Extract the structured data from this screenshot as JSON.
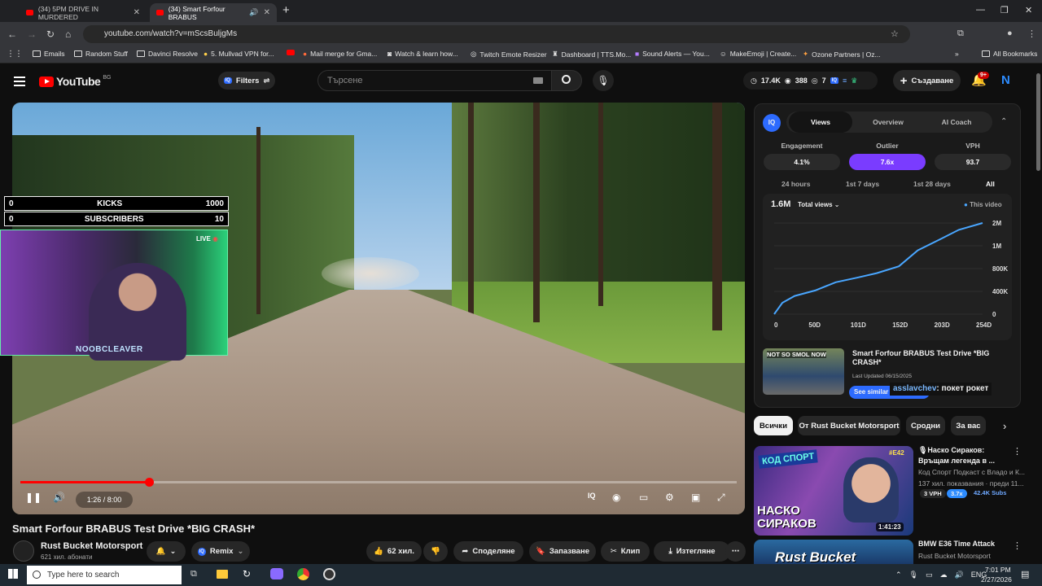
{
  "browser": {
    "tabs": [
      {
        "label": "(34) 5PM DRIVE IN MURDERED"
      },
      {
        "label": "(34) Smart Forfour BRABUS"
      }
    ],
    "url": "youtube.com/watch?v=mScsBuljgMs",
    "bookmarks": [
      "Emails",
      "Random Stuff",
      "Davinci Resolve",
      "5. Mullvad VPN for...",
      "Mail merge for Gma...",
      "Watch & learn how...",
      "Twitch Emote Resizer",
      "Dashboard | TTS.Mo...",
      "Sound Alerts — You...",
      "MakeEmoji | Create...",
      "Ozone Partners | Oz...",
      "All Bookmarks"
    ]
  },
  "header": {
    "logo": "YouTube",
    "region": "BG",
    "filters_label": "Filters",
    "search_placeholder": "Търсене",
    "stats": [
      "17.4K",
      "388",
      "7"
    ],
    "create_label": "Създаване",
    "notif_badge": "9+"
  },
  "video": {
    "kicks": {
      "left": "0",
      "label": "KICKS",
      "right": "1000"
    },
    "subs": {
      "left": "0",
      "label": "SUBSCRIBERS",
      "right": "10"
    },
    "cam_name": "NOOBCLEAVER",
    "live": "LIVE",
    "time": "1:26 / 8:00",
    "progress": 0.18,
    "title": "Smart Forfour BRABUS Test Drive *BIG CRASH*",
    "channel": "Rust Bucket Motorsport",
    "subs_count": "621 хил. абонати",
    "remix": "Remix",
    "likes": "62 хил.",
    "share": "Споделяне",
    "save": "Запазване",
    "clip": "Клип",
    "download": "Изтегляне"
  },
  "vidiq": {
    "tabs": [
      "Views",
      "Overview",
      "AI Coach"
    ],
    "stats": [
      {
        "label": "Engagement",
        "value": "4.1%"
      },
      {
        "label": "Outlier",
        "value": "7.6x"
      },
      {
        "label": "VPH",
        "value": "93.7"
      }
    ],
    "ranges": [
      "24 hours",
      "1st 7 days",
      "1st 28 days",
      "All"
    ],
    "total": "1.6M",
    "metric_select": "Total views",
    "legend": "This video",
    "similar_title": "Smart Forfour BRABUS Test Drive *BIG CRASH*",
    "last_updated": "Last Updated 06/15/2025",
    "similar_btn": "See similar thumbnails",
    "thumb_text": "NOT SO SMOL NOW",
    "chat_user": "asslavchev",
    "chat_msg": ": покет рокет"
  },
  "chart_data": {
    "type": "line",
    "series": [
      {
        "values": [
          [
            0,
            0
          ],
          [
            10,
            250000
          ],
          [
            25,
            400000
          ],
          [
            50,
            520000
          ],
          [
            75,
            700000
          ],
          [
            101,
            800000
          ],
          [
            125,
            900000
          ],
          [
            152,
            1050000
          ],
          [
            175,
            1400000
          ],
          [
            203,
            1650000
          ],
          [
            225,
            1850000
          ],
          [
            254,
            2000000
          ]
        ]
      }
    ],
    "x_ticks": [
      "0",
      "50D",
      "101D",
      "152D",
      "203D",
      "254D"
    ],
    "y_ticks": [
      "2M",
      "1M",
      "800K",
      "400K",
      "0"
    ],
    "xlim": [
      0,
      254
    ],
    "ylim": [
      0,
      2000000
    ]
  },
  "chips": [
    "Всички",
    "От Rust Bucket Motorsport",
    "Сродни",
    "За вас"
  ],
  "recs": [
    {
      "title": "🎙Наско Сираков: Връщам легенда в ...",
      "channel": "Код Спорт Подкаст с Владо и К...",
      "views": "137 хил. показвания · преди 11...",
      "vph": "3 VPH",
      "outlier": "3.7x",
      "subs": "42.4K Subs",
      "duration": "1:41:23",
      "badge": "#E42",
      "thumb_top": "КОД СПОРТ",
      "thumb_text": "НАСКО СИРАКОВ"
    },
    {
      "title": "BMW E36 Time Attack",
      "channel": "Rust Bucket Motorsport",
      "thumb_text": "Rust Bucket"
    }
  ],
  "taskbar": {
    "search": "Type here to search",
    "lang": "ENG",
    "time": "7:01 PM",
    "date": "2/27/2026"
  }
}
